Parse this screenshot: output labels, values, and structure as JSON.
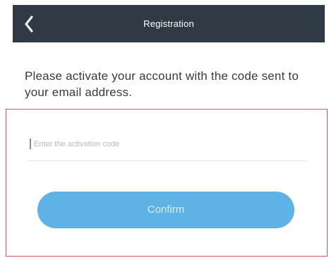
{
  "header": {
    "title": "Registration",
    "back_icon": "chevron-left-icon",
    "background": "#2f3a45"
  },
  "message": {
    "text": "Please activate your account with the code sent to your email address."
  },
  "form": {
    "code_input": {
      "placeholder": "Enter the activation code",
      "value": ""
    },
    "confirm_label": "Confirm",
    "accent": "#5fb2e5",
    "highlight_border": "#d1565a"
  }
}
